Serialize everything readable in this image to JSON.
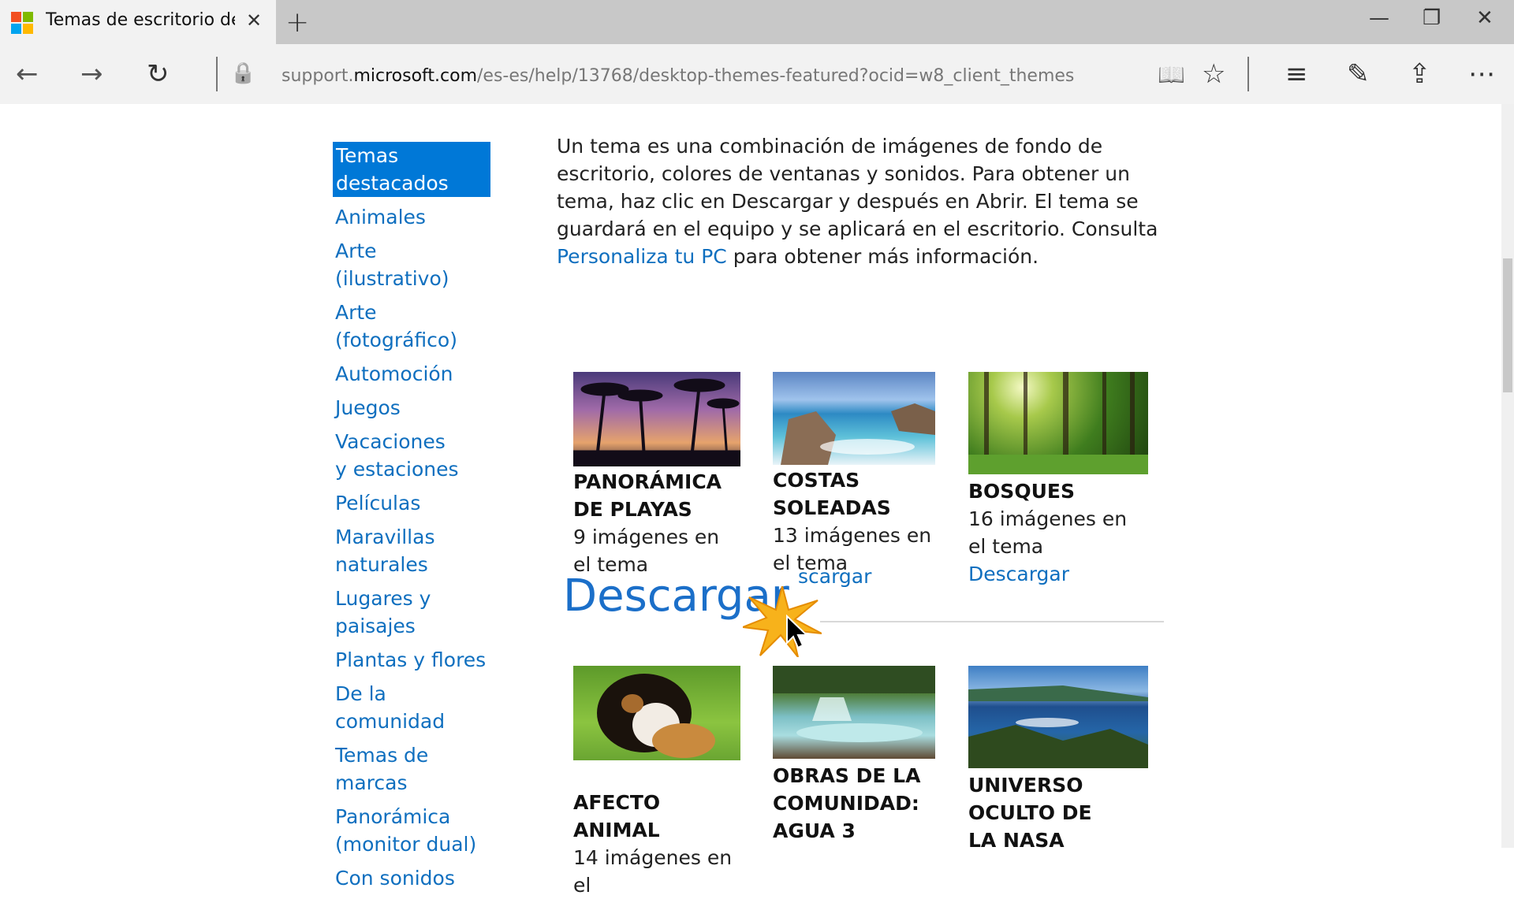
{
  "browser": {
    "tab_title": "Temas de escritorio des",
    "url_prefix": "support.",
    "url_domain": "microsoft.com",
    "url_path": "/es-es/help/13768/desktop-themes-featured?ocid=w8_client_themes"
  },
  "icons": {
    "close": "✕",
    "new_tab": "+",
    "minimize": "—",
    "restore": "❐",
    "window_close": "✕",
    "back": "←",
    "forward": "→",
    "refresh": "↻",
    "lock": "🔒",
    "reading": "📖",
    "star": "☆",
    "hub": "≡",
    "notes": "✎",
    "share": "⇪",
    "more": "⋯"
  },
  "sidebar": {
    "active": "Temas destacados",
    "items": [
      "Animales",
      "Arte (ilustrativo)",
      "Arte (fotográfico)",
      "Automoción",
      "Juegos",
      "Vacaciones y estaciones",
      "Películas",
      "Maravillas naturales",
      "Lugares y paisajes",
      "Plantas y flores",
      "De la comunidad",
      "Temas de marcas",
      "Panorámica (monitor dual)",
      "Con sonidos"
    ]
  },
  "intro": {
    "text_before": "Un tema es una combinación de imágenes de fondo de escritorio, colores de ventanas y sonidos. Para obtener un tema, haz clic en Descargar y después en Abrir. El tema se guardará en el equipo y se aplicará en el escritorio. Consulta ",
    "link": "Personaliza tu PC",
    "text_after": " para obtener más información."
  },
  "themes": [
    {
      "title": "PANORÁMICA DE PLAYAS",
      "count": "9 imágenes en el tema",
      "download": ""
    },
    {
      "title": "COSTAS SOLEADAS",
      "count": "13 imágenes en el tema",
      "download": "scargar"
    },
    {
      "title": "BOSQUES",
      "count": "16 imágenes en el tema",
      "download": "Descargar"
    },
    {
      "title": "AFECTO ANIMAL",
      "count": "14 imágenes en el",
      "download": ""
    },
    {
      "title": "OBRAS DE LA COMUNIDAD: AGUA 3",
      "count": "",
      "download": ""
    },
    {
      "title": "UNIVERSO OCULTO DE LA NASA",
      "count": "",
      "download": ""
    }
  ],
  "overlay": {
    "big_download": "Descargar"
  },
  "colors": {
    "accent": "#0078d7",
    "link": "#0f6fbf"
  }
}
